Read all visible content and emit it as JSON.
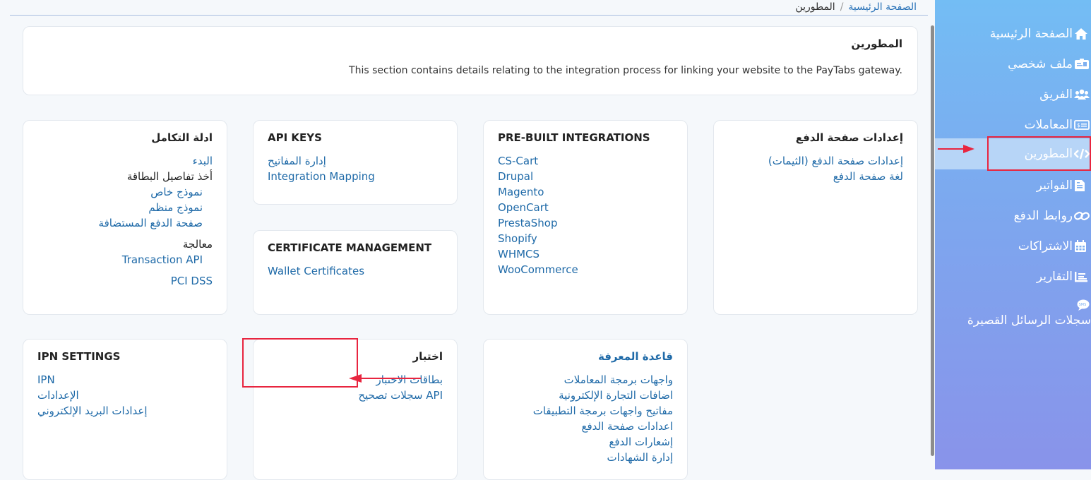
{
  "breadcrumb": {
    "home": "الصفحة الرئيسية",
    "separator": "/",
    "current": "المطورين"
  },
  "header": {
    "title": "المطورين",
    "description": "This section contains details relating to the integration process for linking your website to the PayTabs gateway."
  },
  "tiles": {
    "payment_page_settings": {
      "title": "إعدادات صفحة الدفع",
      "links": [
        "إعدادات صفحة الدفع (الثيمات)",
        "لغة صفحة الدفع"
      ]
    },
    "prebuilt": {
      "title": "PRE-BUILT INTEGRATIONS",
      "links": [
        "CS-Cart",
        "Drupal",
        "Magento",
        "OpenCart",
        "PrestaShop",
        "Shopify",
        "WHMCS",
        "WooCommerce"
      ]
    },
    "api_keys": {
      "title": "API KEYS",
      "links": [
        "إدارة المفاتيح",
        "Integration Mapping"
      ]
    },
    "certificate": {
      "title": "CERTIFICATE MANAGEMENT",
      "links": [
        "Wallet Certificates"
      ]
    },
    "integration_guides": {
      "title": "ادلة التكامل",
      "start": "البدء",
      "card_details": "أخذ تفاصيل البطاقة",
      "card_links": [
        "نموذج خاص",
        "نموذج منظم",
        "صفحة الدفع المستضافة"
      ],
      "processing": "معالجة",
      "processing_links": [
        "Transaction API"
      ],
      "pci": "PCI DSS"
    },
    "knowledge_base": {
      "title": "قاعدة المعرفة",
      "links": [
        "واجهات برمجة المعاملات",
        "اضافات التجارة الإلكترونية",
        "مفاتيح واجهات برمجة التطبيقات",
        "اعدادات صفحة الدفع",
        "إشعارات الدفع",
        "إدارة الشهادات"
      ]
    },
    "testing": {
      "title": "اختبار",
      "links": [
        "بطاقات الاختبار",
        "API سجلات تصحيح"
      ]
    },
    "ipn": {
      "title": "IPN SETTINGS",
      "links": [
        "IPN",
        "الإعدادات",
        "إعدادات البريد الإلكتروني"
      ]
    }
  },
  "sidebar": {
    "items": [
      {
        "label": "الصفحة الرئيسية",
        "icon": "home-icon"
      },
      {
        "label": "ملف شخصي",
        "icon": "id-card-icon"
      },
      {
        "label": "الفريق",
        "icon": "users-icon"
      },
      {
        "label": "المعاملات",
        "icon": "money-bill-icon"
      },
      {
        "label": "المطورين",
        "icon": "code-icon",
        "active": true
      },
      {
        "label": "الفواتير",
        "icon": "invoice-icon"
      },
      {
        "label": "روابط الدفع",
        "icon": "link-icon"
      },
      {
        "label": "الاشتراكات",
        "icon": "calendar-icon"
      },
      {
        "label": "التقارير",
        "icon": "report-icon"
      },
      {
        "label": "سجلات الرسائل القصيرة",
        "icon": "sms-icon",
        "icon_text": "SMS"
      }
    ]
  },
  "colors": {
    "link": "#1f6aa8",
    "annotation": "#e8253f",
    "sidebar_top": "#73bdf4",
    "sidebar_bottom": "#8993ea"
  }
}
